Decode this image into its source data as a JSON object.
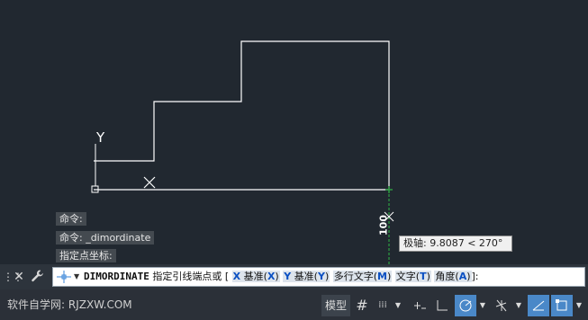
{
  "canvas": {
    "ucs_y_label": "Y",
    "dimension_text": "100"
  },
  "history": {
    "line1": "命令:",
    "line2": "命令: _dimordinate",
    "line3": "指定点坐标:"
  },
  "tooltip": {
    "text": "极轴: 9.8087 < 270°"
  },
  "command_line": {
    "command_name": "DIMORDINATE",
    "prompt_text": "指定引线端点或 [",
    "options": [
      {
        "key": "X",
        "label": "基准(",
        "close": ")"
      },
      {
        "key": "Y",
        "label": "基准(",
        "close": ")"
      },
      {
        "key": "M",
        "label": "多行文字(",
        "close": ")"
      },
      {
        "key": "T",
        "label": "文字(",
        "close": ")"
      },
      {
        "key": "A",
        "label": "角度(",
        "close": ")"
      }
    ],
    "suffix": "]:"
  },
  "status_bar": {
    "watermark": "软件自学网: RJZXW.COM",
    "model_label": "模型"
  },
  "icons": {
    "grip": "⋮⋮",
    "close": "✕",
    "wrench": "🔧",
    "dropdown": "▼",
    "grid": "#",
    "snap": "⁞⁞⁞"
  },
  "colors": {
    "canvas_bg": "#212830",
    "geometry": "#ffffff",
    "extension_line": "#2ea043",
    "active_toggle": "#4a88c8",
    "option_key": "#0a4fc2"
  }
}
